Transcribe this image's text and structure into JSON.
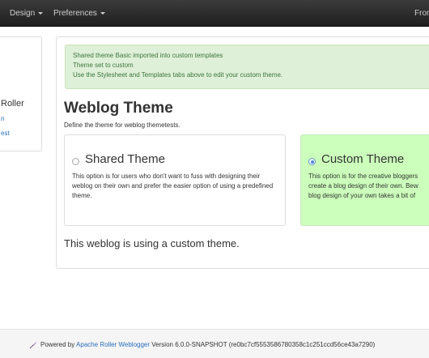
{
  "nav": {
    "design_label": "Design",
    "preferences_label": "Preferences",
    "right_label": "Fron"
  },
  "sidebar": {
    "title": "Roller",
    "link1": "n",
    "link2": "est"
  },
  "alert": {
    "lines": [
      "Shared theme Basic imported into custom templates",
      "Theme set to custom",
      "Use the Stylesheet and Templates tabs above to edit your custom theme."
    ]
  },
  "page": {
    "title": "Weblog Theme",
    "subtitle": "Define the theme for weblog themetests."
  },
  "themes": {
    "shared": {
      "heading": "Shared Theme",
      "description": "This option is for users who don't want to fuss with designing their weblog on their own and prefer the easier option of using a predefined theme."
    },
    "custom": {
      "heading": "Custom Theme",
      "desc_lines": [
        "This option is for the creative bloggers",
        "create a blog design of their own. Bew",
        "blog design of your own takes a bit of"
      ]
    }
  },
  "status": "This weblog is using a custom theme.",
  "footer": {
    "powered_by": "Powered by",
    "link": "Apache Roller Weblogger",
    "version": "Version 6.0.0-SNAPSHOT (re0bc7cf5553586780358c1c251ccd56ce43a7290)"
  },
  "colors": {
    "alert_bg": "#dff0d8",
    "custom_selected_bg": "#ccffbb",
    "link": "#2a6ebb"
  }
}
